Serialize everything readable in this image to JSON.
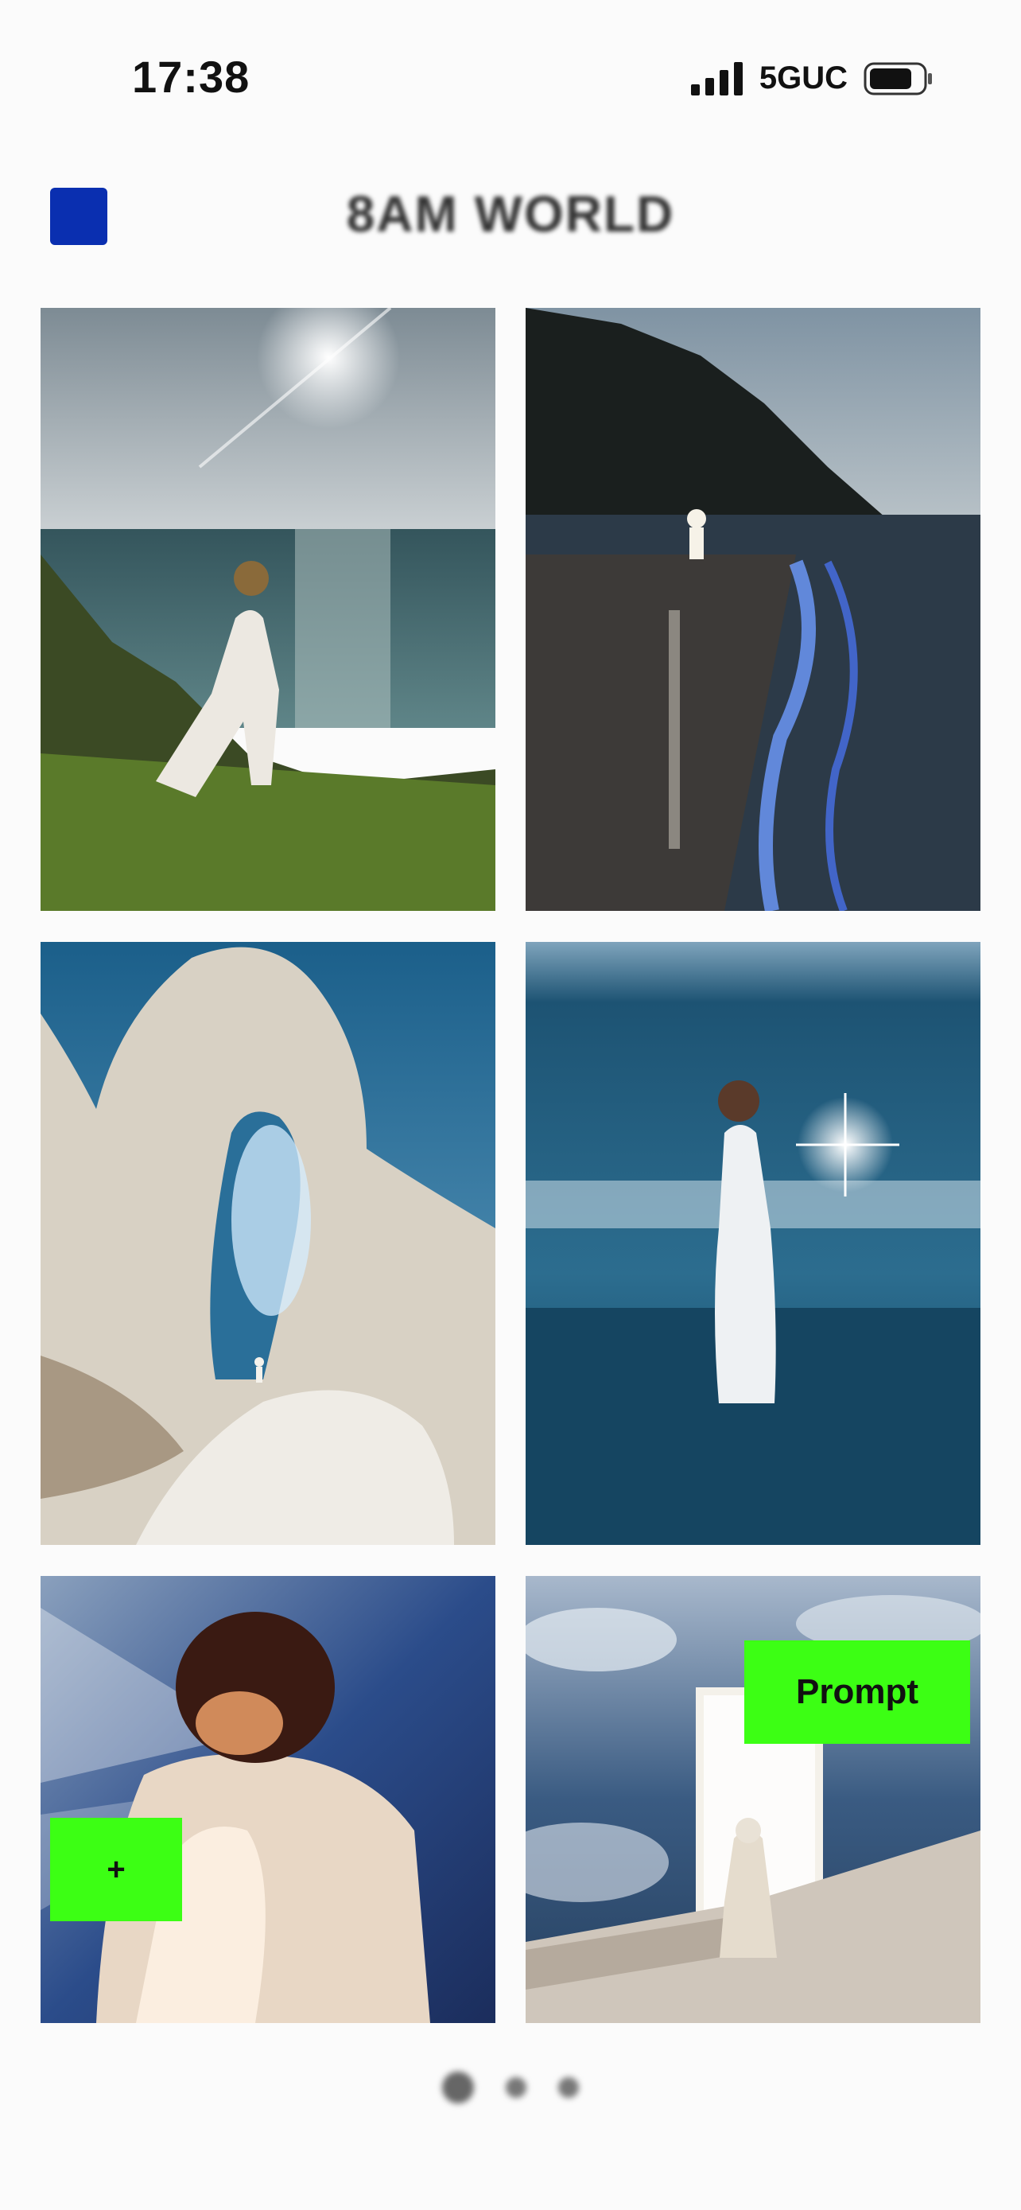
{
  "status_bar": {
    "time": "17:38",
    "network": "5GUC",
    "icons": [
      "cellular-signal-icon",
      "battery-icon"
    ]
  },
  "header": {
    "title": "8AM WORLD",
    "menu_color": "#0a2fb0"
  },
  "gallery": {
    "images": [
      {
        "name": "woman-cliff-ocean-sunburst"
      },
      {
        "name": "beach-night-bioluminescent-waves"
      },
      {
        "name": "white-rock-arch-light-portal"
      },
      {
        "name": "woman-white-dress-shore-sparkle"
      },
      {
        "name": "person-backlit-light-rays"
      },
      {
        "name": "figure-glowing-door-clouds"
      }
    ]
  },
  "actions": {
    "add_label": "+",
    "prompt_label": "Prompt",
    "accent_color": "#3cff14"
  },
  "pager": {
    "pages": 3,
    "current": 1
  }
}
